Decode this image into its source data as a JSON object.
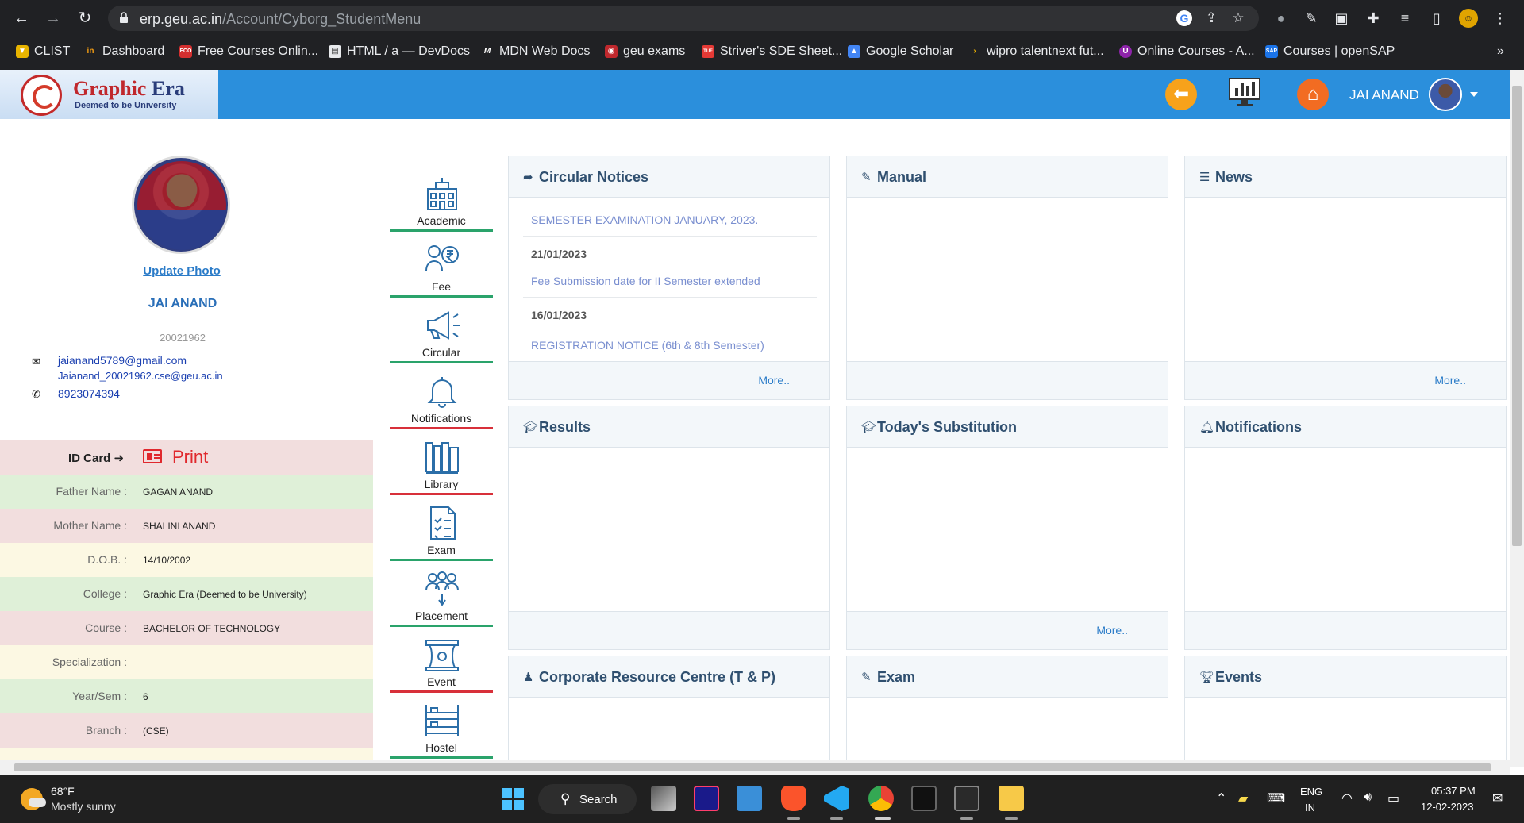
{
  "browser": {
    "url_host": "erp.geu.ac.in",
    "url_path": "/Account/Cyborg_StudentMenu",
    "bookmarks": [
      {
        "label": "CLIST"
      },
      {
        "label": "Dashboard"
      },
      {
        "label": "Free Courses Onlin..."
      },
      {
        "label": "HTML / a — DevDocs"
      },
      {
        "label": "MDN Web Docs"
      },
      {
        "label": "geu exams"
      },
      {
        "label": "Striver's SDE Sheet..."
      },
      {
        "label": "Google Scholar"
      },
      {
        "label": "wipro talentnext fut..."
      },
      {
        "label": "Online Courses - A..."
      },
      {
        "label": "Courses | openSAP"
      }
    ]
  },
  "header": {
    "logo_name_1": "Graphic",
    "logo_name_2": "Era",
    "logo_sub": "Deemed to be University",
    "user_name": "JAI ANAND"
  },
  "profile": {
    "update_photo": "Update Photo",
    "name": "JAI ANAND",
    "id": "20021962",
    "email_personal": "jaianand5789@gmail.com",
    "email_official": "Jaianand_20021962.cse@geu.ac.in",
    "phone": "8923074394"
  },
  "info": {
    "id_card_label": "ID Card",
    "print_label": "Print",
    "rows": [
      {
        "label": "Father Name :",
        "value": "GAGAN ANAND"
      },
      {
        "label": "Mother Name :",
        "value": "SHALINI ANAND"
      },
      {
        "label": "D.O.B. :",
        "value": "14/10/2002"
      },
      {
        "label": "College :",
        "value": "Graphic Era (Deemed to be University)"
      },
      {
        "label": "Course :",
        "value": "BACHELOR OF TECHNOLOGY"
      },
      {
        "label": "Specialization :",
        "value": ""
      },
      {
        "label": "Year/Sem :",
        "value": "6"
      },
      {
        "label": "Branch :",
        "value": "(CSE)"
      }
    ]
  },
  "modules": [
    {
      "label": "Academic",
      "icon": "academic-building-icon"
    },
    {
      "label": "Fee",
      "icon": "fee-icon"
    },
    {
      "label": "Circular",
      "icon": "megaphone-icon"
    },
    {
      "label": "Notifications",
      "icon": "bell-icon"
    },
    {
      "label": "Library",
      "icon": "library-books-icon"
    },
    {
      "label": "Exam",
      "icon": "exam-checklist-icon"
    },
    {
      "label": "Placement",
      "icon": "placement-people-icon"
    },
    {
      "label": "Event",
      "icon": "event-stage-icon"
    },
    {
      "label": "Hostel",
      "icon": "hostel-bed-icon"
    }
  ],
  "panels": {
    "circular": {
      "title": "Circular Notices",
      "item1": "SEMESTER EXAMINATION JANUARY, 2023.",
      "date2": "21/01/2023",
      "item2": "Fee Submission date for II Semester extended",
      "date3": "16/01/2023",
      "item3": "REGISTRATION NOTICE (6th & 8th Semester)",
      "more": "More.."
    },
    "manual": {
      "title": "Manual"
    },
    "news": {
      "title": "News",
      "more": "More.."
    },
    "results": {
      "title": "Results"
    },
    "substitution": {
      "title": "Today's Substitution",
      "more": "More.."
    },
    "notifications": {
      "title": "Notifications"
    },
    "crc": {
      "title": "Corporate Resource Centre (T & P)"
    },
    "exam": {
      "title": "Exam"
    },
    "events": {
      "title": "Events"
    }
  },
  "taskbar": {
    "weather_temp": "68°F",
    "weather_desc": "Mostly sunny",
    "search_label": "Search",
    "lang1": "ENG",
    "lang2": "IN",
    "time": "05:37 PM",
    "date": "12-02-2023"
  },
  "colors": {
    "header_blue": "#2b8fdc",
    "row_pink": "#f2dede",
    "row_green": "#dff0d8",
    "row_yellow": "#fcf8e3",
    "module_green": "#2aa36b",
    "module_red": "#d8303a"
  }
}
